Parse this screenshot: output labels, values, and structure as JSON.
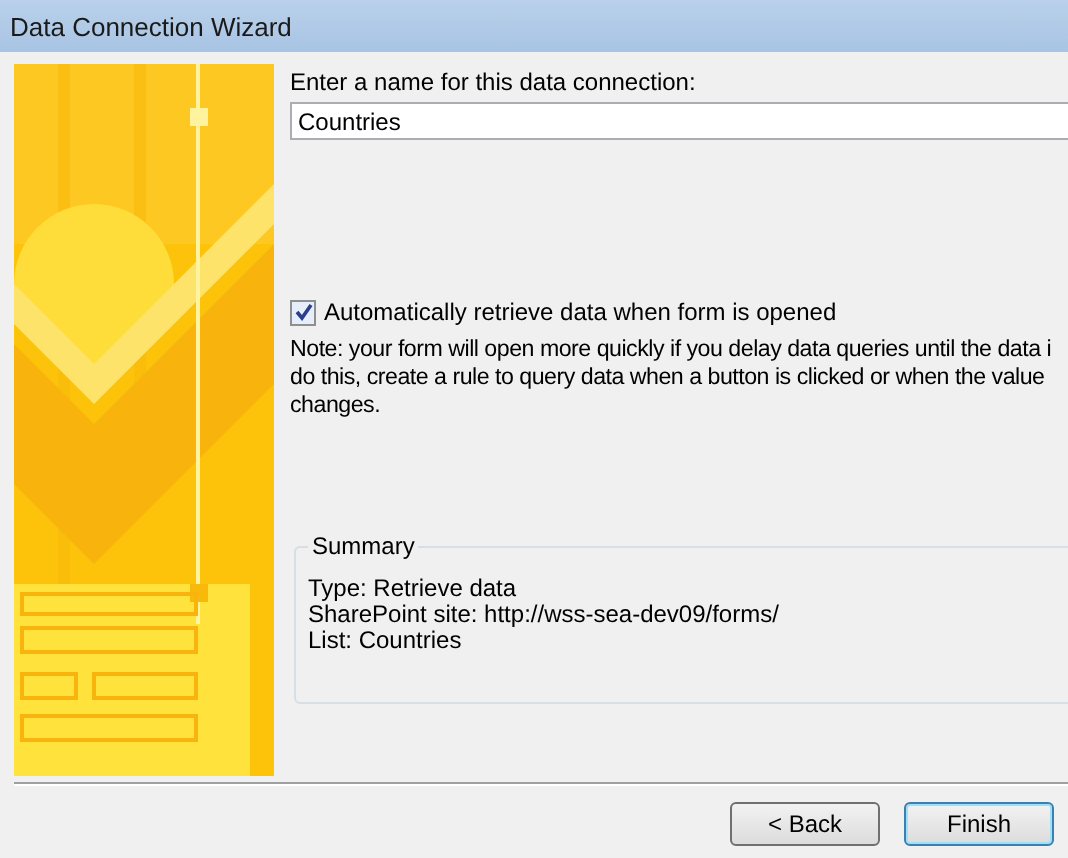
{
  "window": {
    "title": "Data Connection Wizard"
  },
  "name_field": {
    "label": "Enter a name for this data connection:",
    "value": "Countries"
  },
  "auto_retrieve": {
    "label": "Automatically retrieve data when form is opened",
    "checked": true
  },
  "note": [
    "Note: your form will open more quickly if you delay data queries until the data i",
    "do this, create a rule to query data when a button is clicked or when the value",
    "changes."
  ],
  "summary": {
    "title": "Summary",
    "lines": [
      "Type: Retrieve data",
      "SharePoint site: http://wss-sea-dev09/forms/",
      "List: Countries"
    ]
  },
  "buttons": [
    {
      "label": "< Back",
      "default": false
    },
    {
      "label": "Finish",
      "default": true
    }
  ]
}
